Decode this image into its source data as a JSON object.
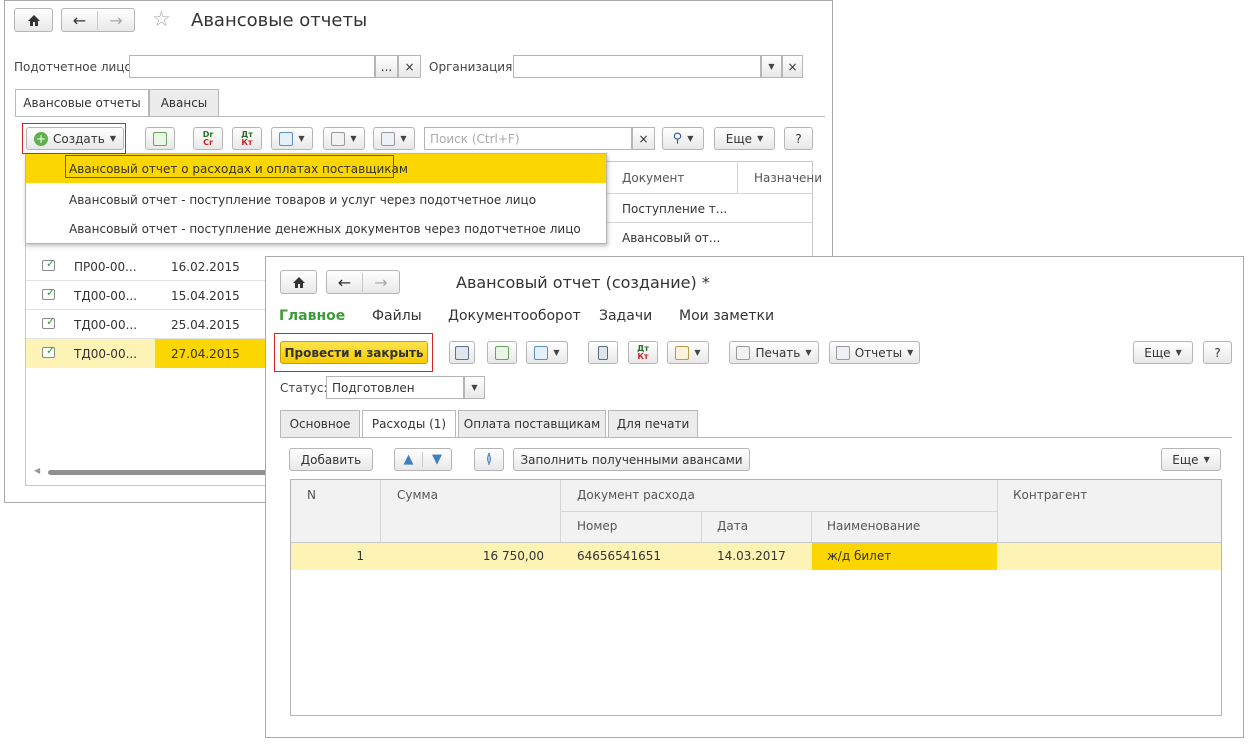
{
  "win1": {
    "title": "Авансовые отчеты",
    "filters": {
      "person_label": "Подотчетное лицо:",
      "org_label": "Организация:",
      "dots": "...",
      "clear": "×"
    },
    "tabs": [
      "Авансовые отчеты",
      "Авансы"
    ],
    "toolbar": {
      "create": "Создать",
      "search_placeholder": "Поиск (Ctrl+F)",
      "more": "Еще",
      "help": "?",
      "dtct_top": "Dr",
      "dtct_bottom": "Cr",
      "dtkt_top": "Дт",
      "dtkt_bottom": "Кт"
    },
    "menu": [
      "Авансовый отчет о расходах и оплатах поставщикам",
      "Авансовый отчет - поступление товаров и услуг через подотчетное лицо",
      "Авансовый отчет - поступление денежных документов через подотчетное лицо"
    ],
    "columns": {
      "document": "Документ",
      "purpose": "Назначени"
    },
    "doc_cells": [
      "Поступление т...",
      "Авансовый от..."
    ],
    "rows": [
      {
        "num": "ПР00-00...",
        "date": "16.02.2015"
      },
      {
        "num": "ТД00-00...",
        "date": "15.04.2015"
      },
      {
        "num": "ТД00-00...",
        "date": "25.04.2015"
      },
      {
        "num": "ТД00-00...",
        "date": "27.04.2015"
      }
    ]
  },
  "win2": {
    "title": "Авансовый отчет (создание) *",
    "sections": [
      "Главное",
      "Файлы",
      "Документооборот",
      "Задачи",
      "Мои заметки"
    ],
    "toolbar": {
      "post_close": "Провести и закрыть",
      "print": "Печать",
      "reports": "Отчеты",
      "more": "Еще",
      "help": "?",
      "dtkt_top": "Дт",
      "dtkt_bottom": "Кт"
    },
    "status_label": "Статус:",
    "status_value": "Подготовлен",
    "tabs": [
      "Основное",
      "Расходы (1)",
      "Оплата поставщикам",
      "Для печати"
    ],
    "tab_toolbar": {
      "add": "Добавить",
      "fill": "Заполнить полученными авансами",
      "more": "Еще"
    },
    "table": {
      "headers": {
        "n": "N",
        "sum": "Сумма",
        "expense_doc": "Документ расхода",
        "number": "Номер",
        "date": "Дата",
        "name": "Наименование",
        "counterparty": "Контрагент"
      },
      "rows": [
        {
          "n": "1",
          "sum": "16 750,00",
          "number": "64656541651",
          "date": "14.03.2017",
          "name": "ж/д билет",
          "counterparty": ""
        }
      ]
    }
  },
  "colors": {
    "accent_yellow": "#fcd600",
    "selected_row": "#fcf3b5",
    "section_active": "#3e9b3a",
    "red_highlight": "#d42424"
  }
}
